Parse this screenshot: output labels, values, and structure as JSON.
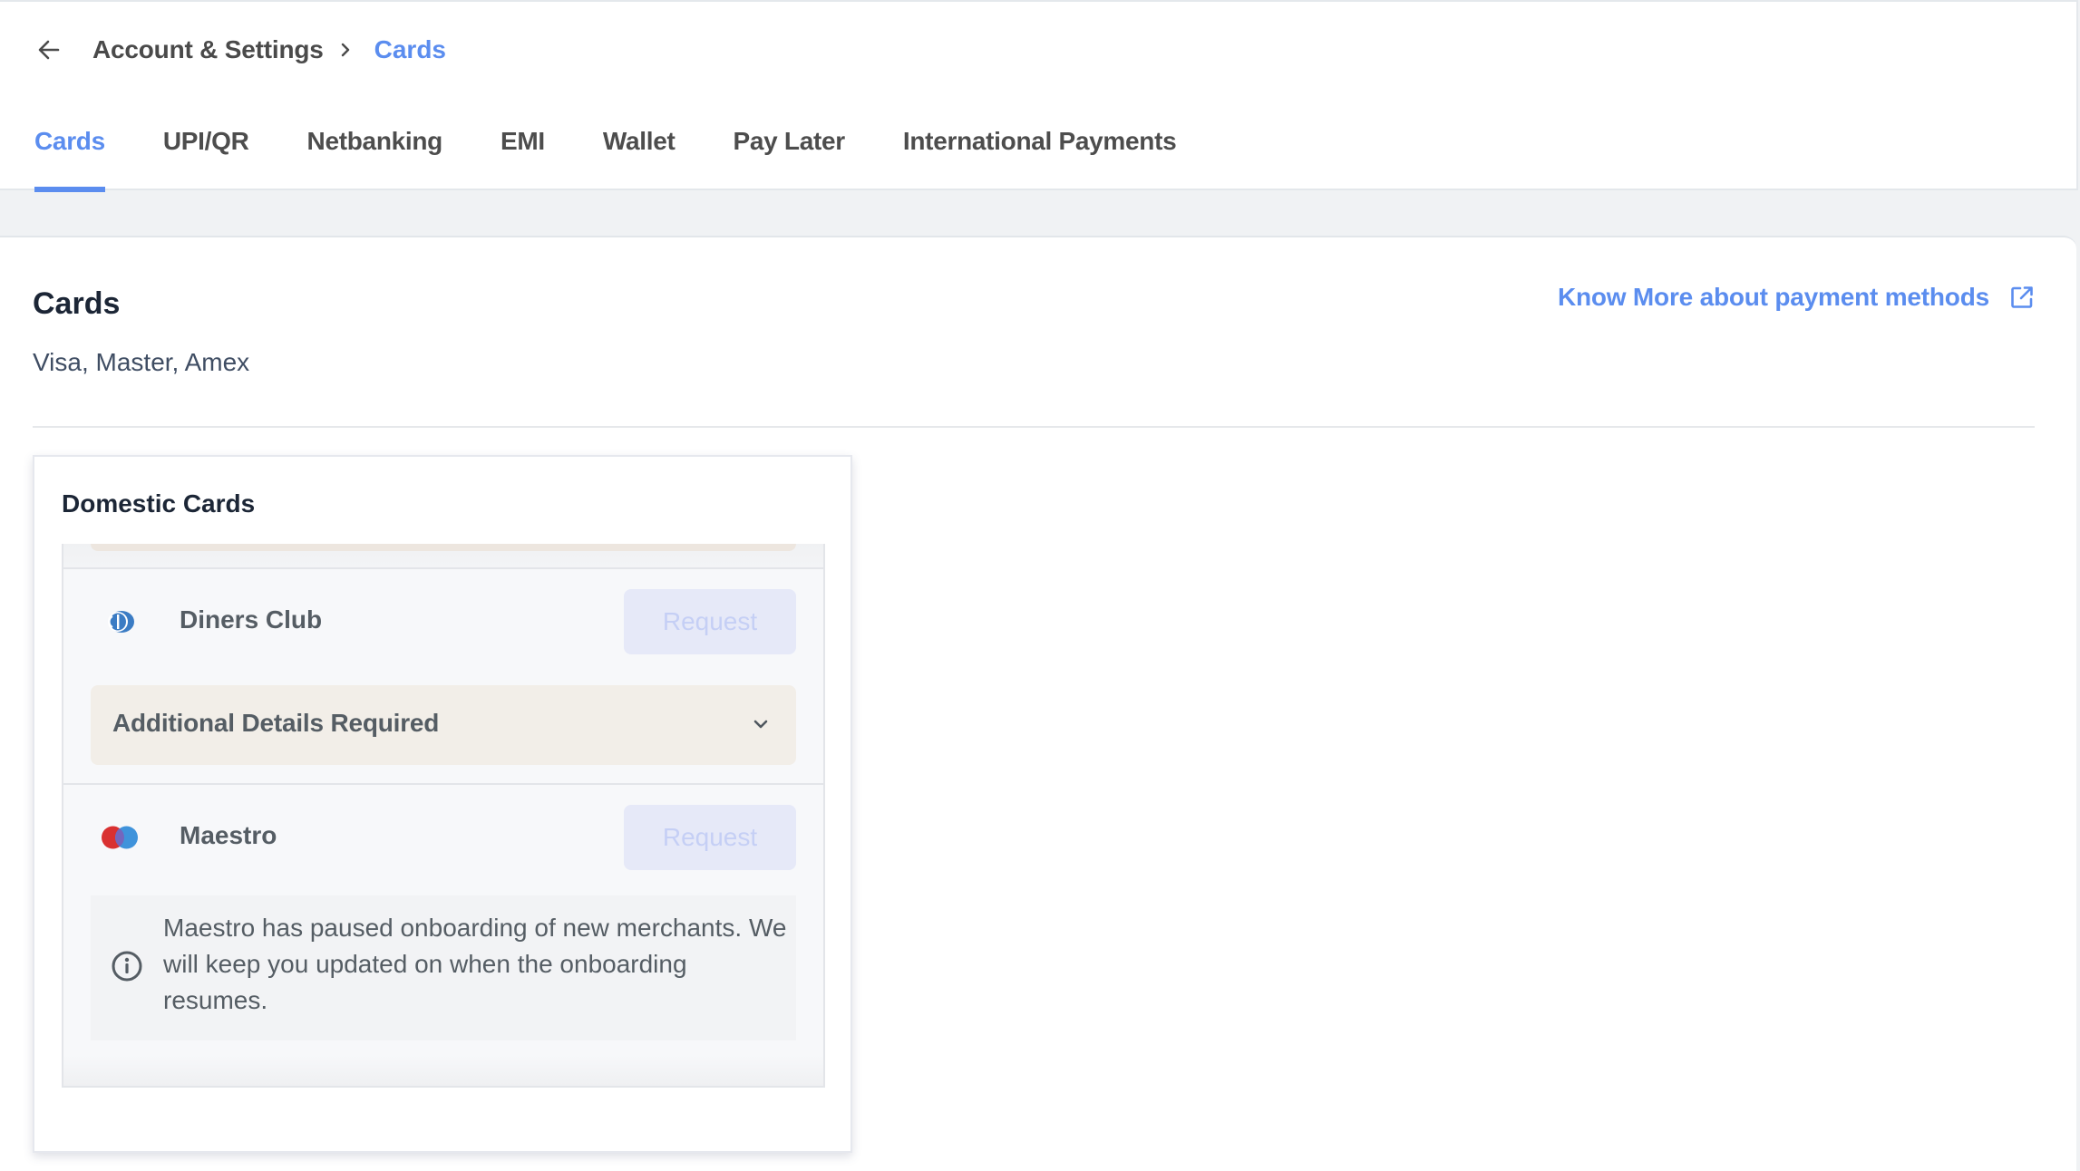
{
  "header": {
    "breadcrumb": {
      "back_icon": "arrow-left-icon",
      "parent": "Account & Settings",
      "separator_icon": "chevron-right-icon",
      "current": "Cards"
    },
    "tabs": [
      {
        "label": "Cards",
        "active": true
      },
      {
        "label": "UPI/QR",
        "active": false
      },
      {
        "label": "Netbanking",
        "active": false
      },
      {
        "label": "EMI",
        "active": false
      },
      {
        "label": "Wallet",
        "active": false
      },
      {
        "label": "Pay Later",
        "active": false
      },
      {
        "label": "International Payments",
        "active": false
      }
    ]
  },
  "section": {
    "title": "Cards",
    "subtitle": "Visa, Master, Amex",
    "know_more_label": "Know More about payment methods",
    "know_more_icon": "external-link-icon"
  },
  "domestic_cards": {
    "title": "Domestic Cards",
    "items": [
      {
        "name": "Diners Club",
        "icon": "diners-club-logo-icon",
        "action_label": "Request",
        "action_disabled": true,
        "accordion_label": "Additional Details Required",
        "accordion_icon": "chevron-down-icon"
      },
      {
        "name": "Maestro",
        "icon": "maestro-logo-icon",
        "action_label": "Request",
        "action_disabled": true,
        "info_icon": "info-icon",
        "info_text": "Maestro has paused onboarding of new merchants. We will keep you updated on when the onboarding resumes."
      }
    ]
  },
  "colors": {
    "accent": "#5b8def",
    "text_dark": "#1c2636",
    "text_muted": "#555d64",
    "request_bg": "#e6e9f8",
    "request_text": "#c5cff5",
    "accordion_bg": "#f2eee8",
    "info_bg": "#f2f3f5",
    "page_bg": "#f0f2f4"
  }
}
